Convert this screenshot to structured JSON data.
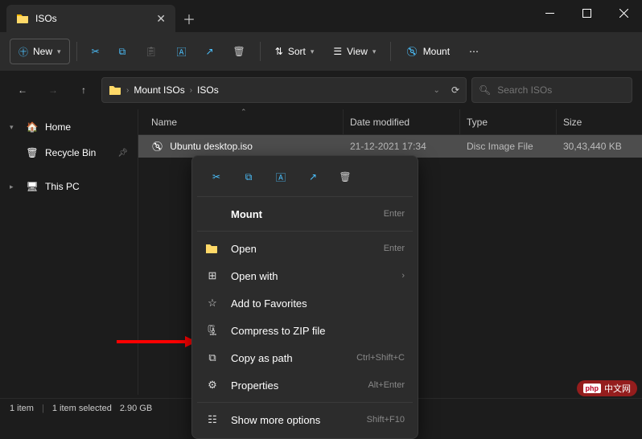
{
  "tab": {
    "title": "ISOs"
  },
  "toolbar": {
    "new": "New",
    "sort": "Sort",
    "view": "View",
    "mount": "Mount"
  },
  "breadcrumb": [
    "Mount ISOs",
    "ISOs"
  ],
  "search": {
    "placeholder": "Search ISOs"
  },
  "sidebar": {
    "home": "Home",
    "recycle": "Recycle Bin",
    "thispc": "This PC"
  },
  "columns": {
    "name": "Name",
    "date": "Date modified",
    "type": "Type",
    "size": "Size"
  },
  "files": [
    {
      "name": "Ubuntu desktop.iso",
      "date": "21-12-2021 17:34",
      "type": "Disc Image File",
      "size": "30,43,440 KB"
    }
  ],
  "status": {
    "count": "1 item",
    "selected": "1 item selected",
    "size": "2.90 GB"
  },
  "ctx": {
    "mount": "Mount",
    "mount_hint": "Enter",
    "open": "Open",
    "open_hint": "Enter",
    "openwith": "Open with",
    "fav": "Add to Favorites",
    "zip": "Compress to ZIP file",
    "copypath": "Copy as path",
    "copypath_hint": "Ctrl+Shift+C",
    "props": "Properties",
    "props_hint": "Alt+Enter",
    "more": "Show more options",
    "more_hint": "Shift+F10"
  },
  "watermark": "中文网"
}
